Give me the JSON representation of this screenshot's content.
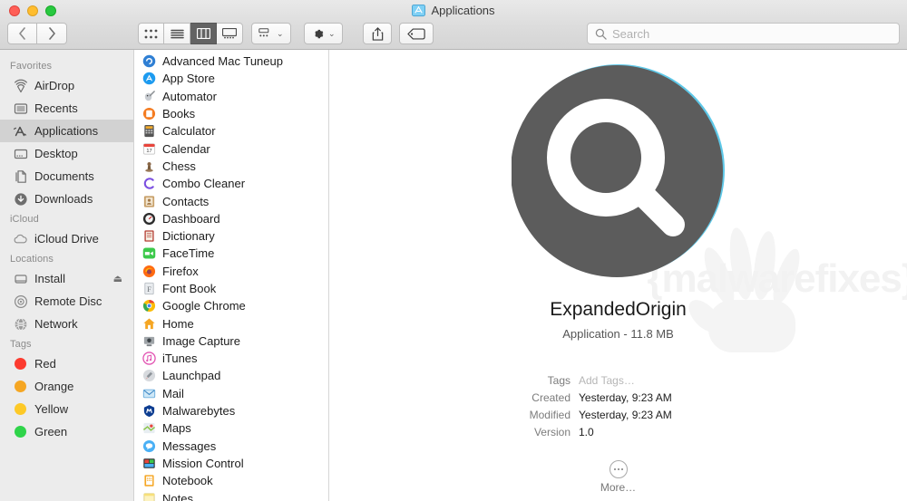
{
  "window": {
    "title": "Applications",
    "title_icon": "applications-folder-icon",
    "traffic_lights": [
      {
        "name": "close",
        "color": "#ff5f57"
      },
      {
        "name": "minimize",
        "color": "#ffbd2e"
      },
      {
        "name": "zoom",
        "color": "#28c840"
      }
    ]
  },
  "toolbar": {
    "back_label": "‹",
    "forward_label": "›",
    "views": [
      {
        "name": "icon-view",
        "selected": false
      },
      {
        "name": "list-view",
        "selected": false
      },
      {
        "name": "column-view",
        "selected": true
      },
      {
        "name": "gallery-view",
        "selected": false
      }
    ],
    "arrange_label": "arrange-button",
    "action_label": "action-gear-button",
    "share_label": "share-button",
    "tags_label": "tags-button",
    "chevron": "⌄"
  },
  "search": {
    "placeholder": "Search",
    "value": ""
  },
  "sidebar": {
    "sections": [
      {
        "heading": "Favorites",
        "items": [
          {
            "label": "AirDrop",
            "icon": "airdrop-icon",
            "selected": false
          },
          {
            "label": "Recents",
            "icon": "recents-clock-icon",
            "selected": false
          },
          {
            "label": "Applications",
            "icon": "applications-icon",
            "selected": true
          },
          {
            "label": "Desktop",
            "icon": "desktop-icon",
            "selected": false
          },
          {
            "label": "Documents",
            "icon": "documents-icon",
            "selected": false
          },
          {
            "label": "Downloads",
            "icon": "downloads-icon",
            "selected": false
          }
        ]
      },
      {
        "heading": "iCloud",
        "items": [
          {
            "label": "iCloud Drive",
            "icon": "icloud-drive-icon",
            "selected": false
          }
        ]
      },
      {
        "heading": "Locations",
        "items": [
          {
            "label": "Install",
            "icon": "disk-icon",
            "selected": false,
            "eject": "⏏"
          },
          {
            "label": "Remote Disc",
            "icon": "remote-disc-icon",
            "selected": false
          },
          {
            "label": "Network",
            "icon": "network-globe-icon",
            "selected": false
          }
        ]
      },
      {
        "heading": "Tags",
        "items": [
          {
            "label": "Red",
            "icon": "tag-dot-icon",
            "color": "#fc3b2f",
            "selected": false
          },
          {
            "label": "Orange",
            "icon": "tag-dot-icon",
            "color": "#f5a623",
            "selected": false
          },
          {
            "label": "Yellow",
            "icon": "tag-dot-icon",
            "color": "#fdc927",
            "selected": false
          },
          {
            "label": "Green",
            "icon": "tag-dot-icon",
            "color": "#2fd44a",
            "selected": false
          }
        ]
      }
    ]
  },
  "file_list": {
    "items": [
      {
        "name": "Advanced Mac Tuneup",
        "icon": "app-icon-advanced-mac-tuneup"
      },
      {
        "name": "App Store",
        "icon": "app-icon-app-store"
      },
      {
        "name": "Automator",
        "icon": "app-icon-automator"
      },
      {
        "name": "Books",
        "icon": "app-icon-books"
      },
      {
        "name": "Calculator",
        "icon": "app-icon-calculator"
      },
      {
        "name": "Calendar",
        "icon": "app-icon-calendar"
      },
      {
        "name": "Chess",
        "icon": "app-icon-chess"
      },
      {
        "name": "Combo Cleaner",
        "icon": "app-icon-combo-cleaner"
      },
      {
        "name": "Contacts",
        "icon": "app-icon-contacts"
      },
      {
        "name": "Dashboard",
        "icon": "app-icon-dashboard"
      },
      {
        "name": "Dictionary",
        "icon": "app-icon-dictionary"
      },
      {
        "name": "FaceTime",
        "icon": "app-icon-facetime"
      },
      {
        "name": "Firefox",
        "icon": "app-icon-firefox"
      },
      {
        "name": "Font Book",
        "icon": "app-icon-font-book"
      },
      {
        "name": "Google Chrome",
        "icon": "app-icon-google-chrome"
      },
      {
        "name": "Home",
        "icon": "app-icon-home"
      },
      {
        "name": "Image Capture",
        "icon": "app-icon-image-capture"
      },
      {
        "name": "iTunes",
        "icon": "app-icon-itunes"
      },
      {
        "name": "Launchpad",
        "icon": "app-icon-launchpad"
      },
      {
        "name": "Mail",
        "icon": "app-icon-mail"
      },
      {
        "name": "Malwarebytes",
        "icon": "app-icon-malwarebytes"
      },
      {
        "name": "Maps",
        "icon": "app-icon-maps"
      },
      {
        "name": "Messages",
        "icon": "app-icon-messages"
      },
      {
        "name": "Mission Control",
        "icon": "app-icon-mission-control"
      },
      {
        "name": "Notebook",
        "icon": "app-icon-notebook"
      },
      {
        "name": "Notes",
        "icon": "app-icon-notes"
      }
    ]
  },
  "preview": {
    "icon": "magnifier-app-icon",
    "name": "ExpandedOrigin",
    "kind_and_size": "Application - 11.8 MB",
    "metadata": [
      {
        "label": "Tags",
        "value": "Add Tags…",
        "placeholder": true
      },
      {
        "label": "Created",
        "value": "Yesterday, 9:23 AM",
        "placeholder": false
      },
      {
        "label": "Modified",
        "value": "Yesterday, 9:23 AM",
        "placeholder": false
      },
      {
        "label": "Version",
        "value": "1.0",
        "placeholder": false
      }
    ],
    "more_label": "More…",
    "watermark": "{malwarefixes}"
  }
}
